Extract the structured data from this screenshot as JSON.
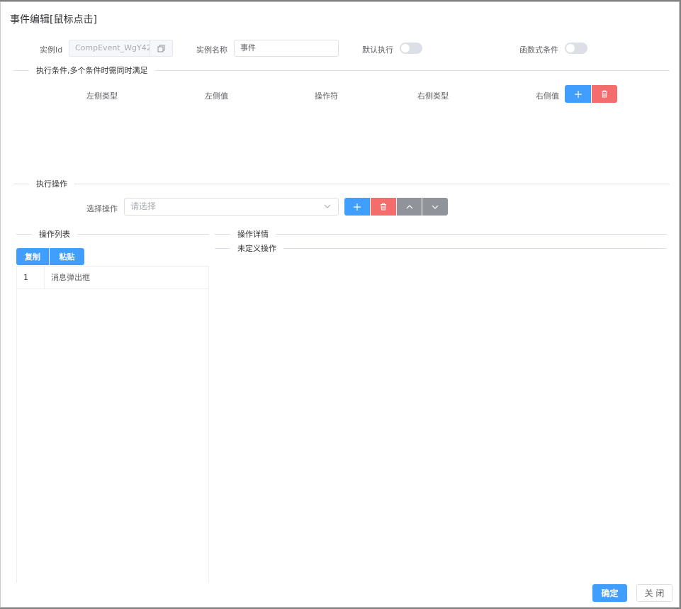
{
  "dialog": {
    "title": "事件编辑[鼠标点击]"
  },
  "basic": {
    "instance_id_label": "实例Id",
    "instance_id_value": "CompEvent_WgY42",
    "instance_name_label": "实例名称",
    "instance_name_value": "事件",
    "default_exec_label": "默认执行",
    "default_exec_on": false,
    "func_cond_label": "函数式条件",
    "func_cond_on": false
  },
  "conditions": {
    "section_title": "执行条件,多个条件时需同时满足",
    "columns": [
      "左侧类型",
      "左侧值",
      "操作符",
      "右侧类型",
      "右侧值"
    ],
    "add_icon": "plus-icon",
    "delete_icon": "trash-icon"
  },
  "operations": {
    "section_title": "执行操作",
    "select_label": "选择操作",
    "select_placeholder": "请选择",
    "icons": [
      "plus-icon",
      "trash-icon",
      "chevron-up-icon",
      "chevron-down-icon"
    ]
  },
  "op_list": {
    "section_title": "操作列表",
    "copy_label": "复制",
    "paste_label": "粘贴",
    "items": [
      {
        "index": "1",
        "name": "消息弹出框"
      }
    ]
  },
  "op_detail": {
    "section_title": "操作详情",
    "sub_title": "未定义操作"
  },
  "footer": {
    "confirm_label": "确定",
    "close_label": "关 闭"
  },
  "colors": {
    "primary": "#409eff",
    "danger": "#f56c6c",
    "info": "#909399"
  }
}
